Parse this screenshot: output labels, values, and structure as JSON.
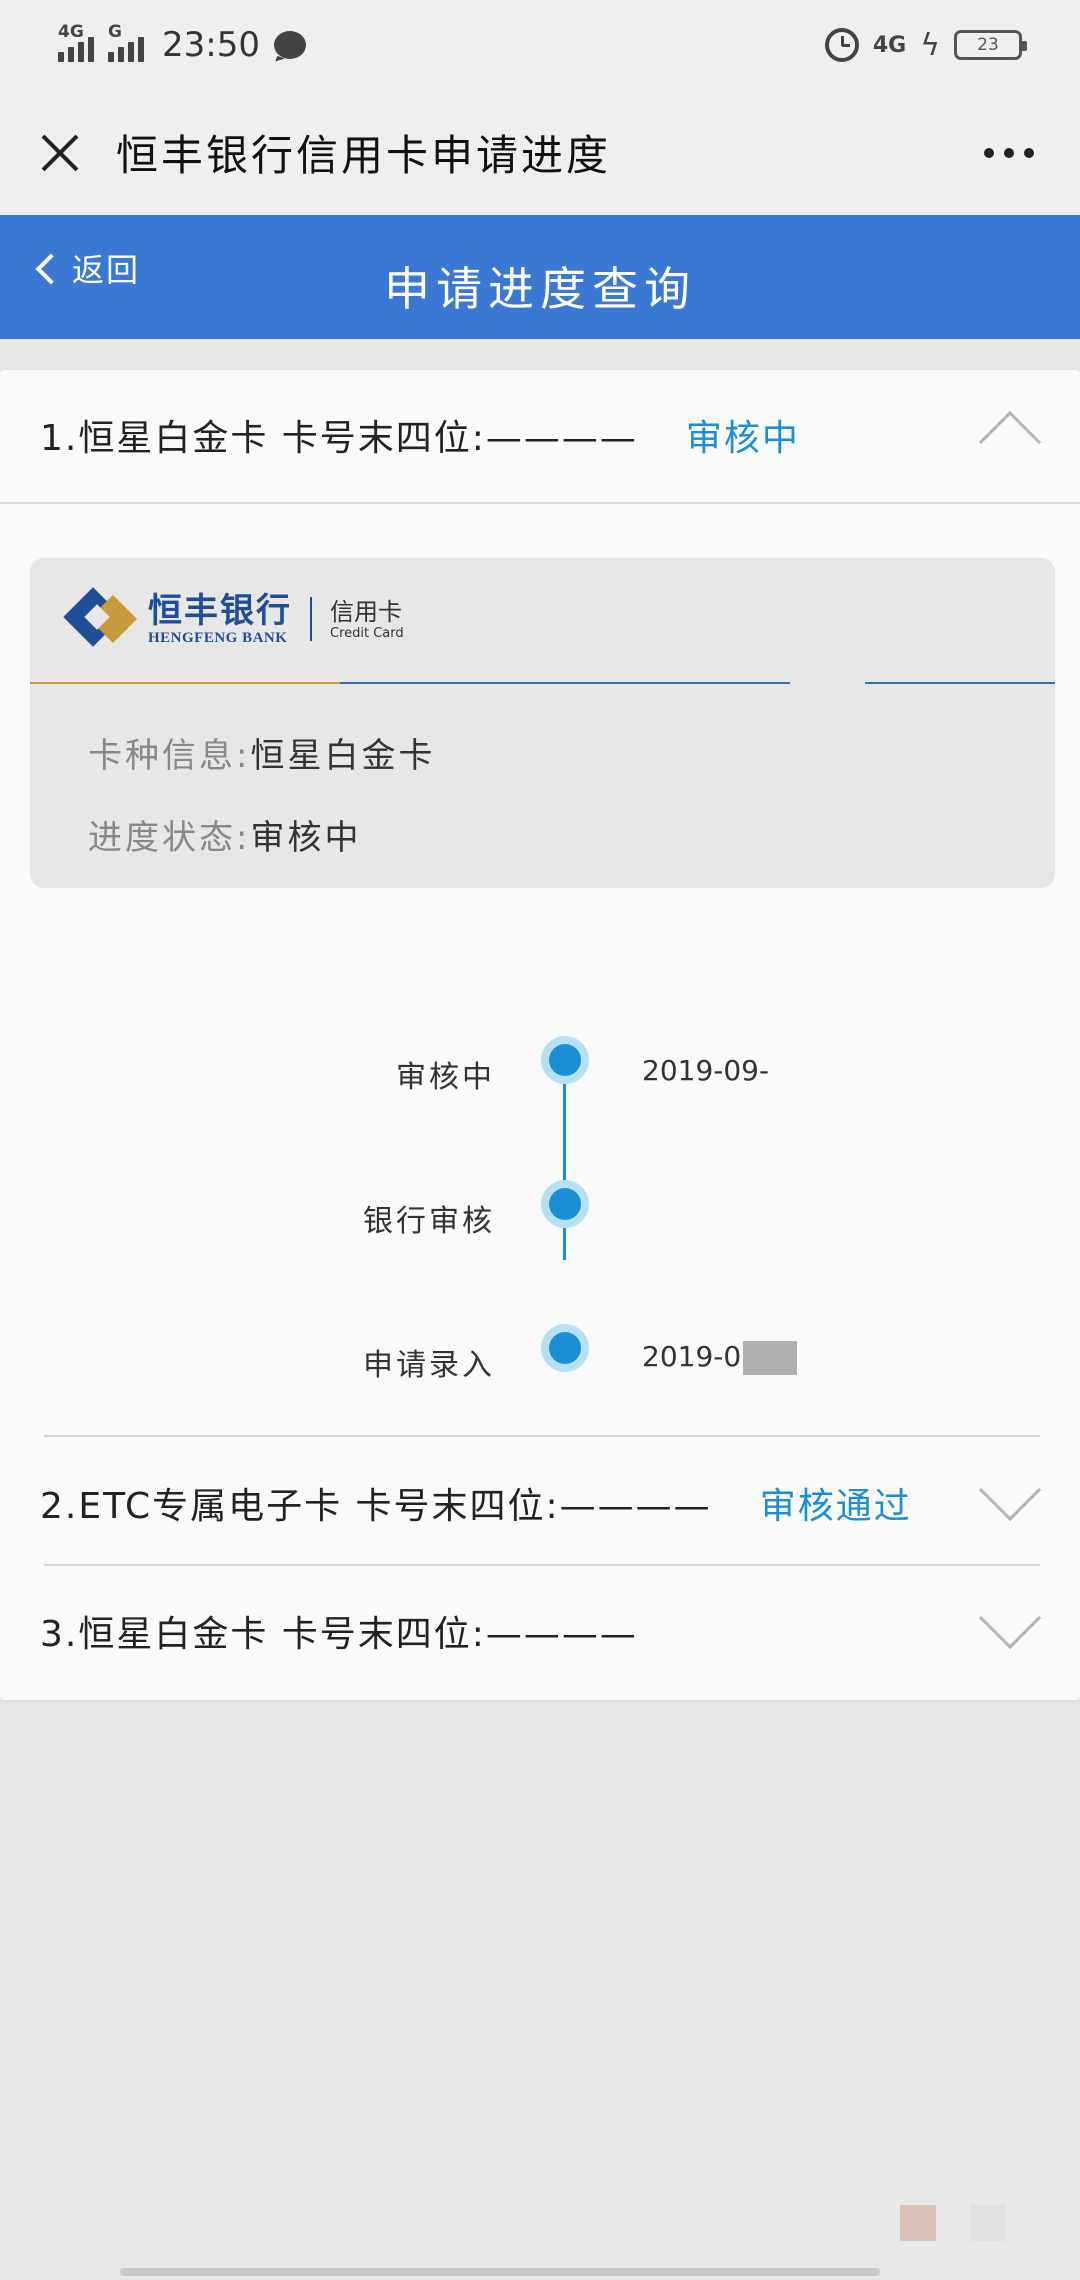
{
  "status_bar": {
    "net1": "4G",
    "net2": "G",
    "time": "23:50",
    "net_right": "4G",
    "battery": "23"
  },
  "title_bar": {
    "title": "恒丰银行信用卡申请进度"
  },
  "header": {
    "back_label": "返回",
    "title": "申请进度查询"
  },
  "applications": [
    {
      "title": "1.恒星白金卡 卡号末四位:————",
      "status": "审核中",
      "expanded": true
    },
    {
      "title": "2.ETC专属电子卡 卡号末四位:————",
      "status": "审核通过",
      "expanded": false
    },
    {
      "title": "3.恒星白金卡 卡号末四位:————",
      "status": "",
      "expanded": false
    }
  ],
  "card": {
    "logo_cn": "恒丰银行",
    "logo_en": "HENGFENG BANK",
    "logo_card_cn": "信用卡",
    "logo_card_en": "Credit Card",
    "type_label": "卡种信息:",
    "type_value": "恒星白金卡",
    "progress_label": "进度状态:",
    "progress_value": "审核中"
  },
  "timeline": [
    {
      "label": "审核中",
      "date": "2019-09-"
    },
    {
      "label": "银行审核",
      "date": ""
    },
    {
      "label": "申请录入",
      "date": "2019-0"
    }
  ],
  "colors": {
    "header_blue": "#3a78d4",
    "status_blue": "#1a8fd6",
    "brand_navy": "#1f4e96",
    "brand_gold": "#c99a3a"
  }
}
